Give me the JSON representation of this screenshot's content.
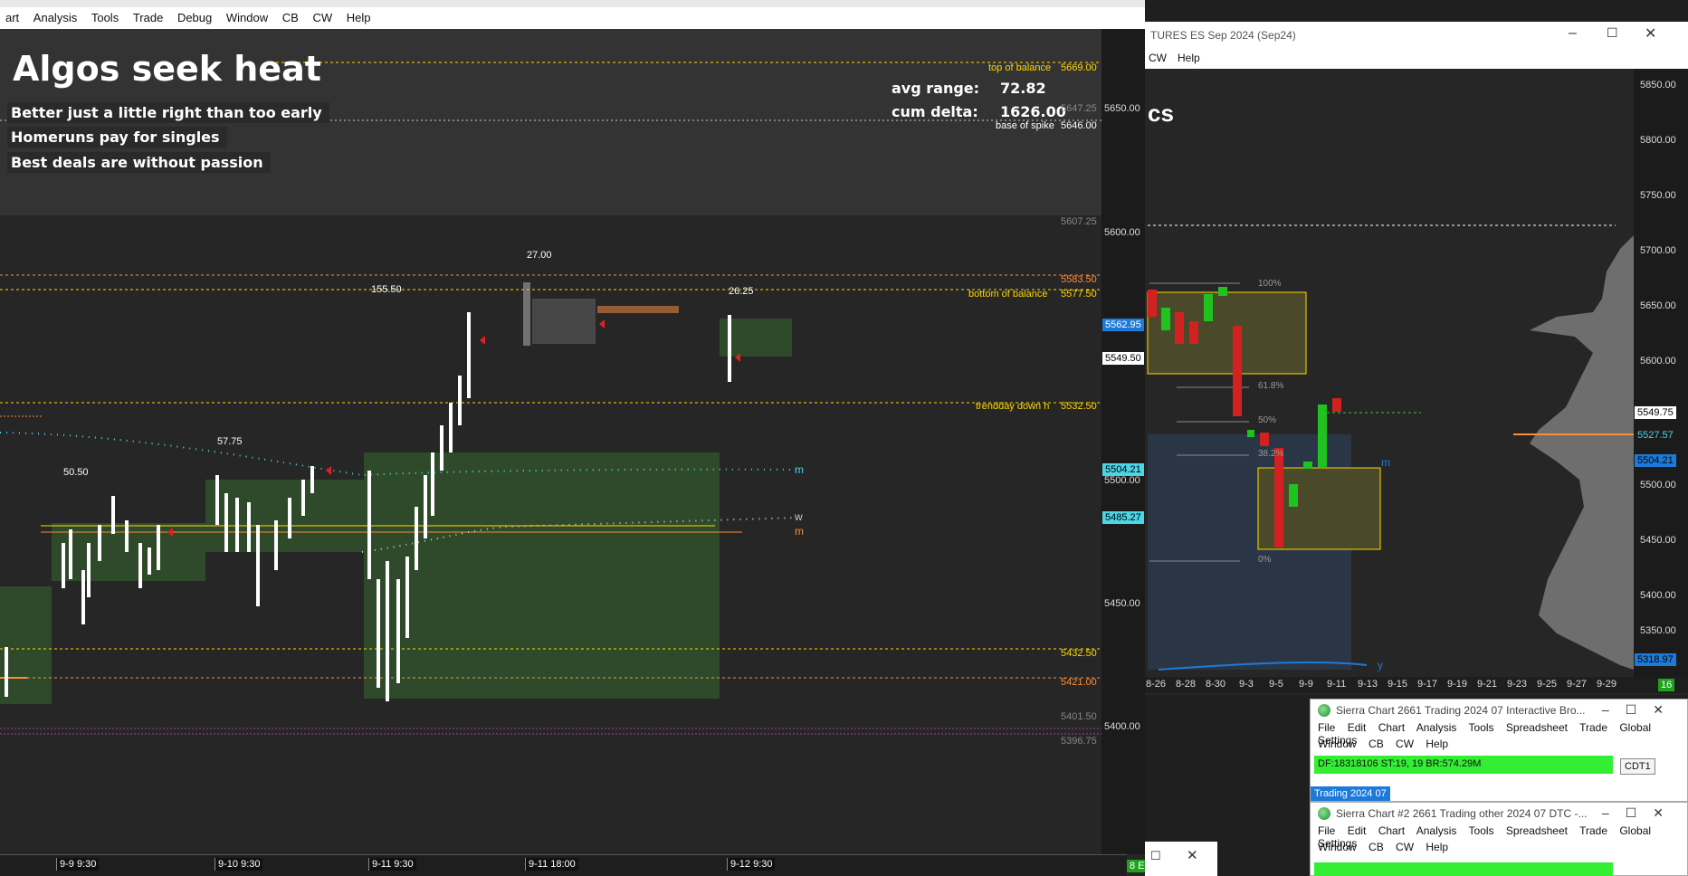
{
  "left_window": {
    "menu": [
      "art",
      "Analysis",
      "Tools",
      "Trade",
      "Debug",
      "Window",
      "CB",
      "CW",
      "Help"
    ],
    "title": "Algos seek heat",
    "mottos": [
      "Better just a little right than too early",
      "Homeruns pay for singles",
      "Best deals are without passion"
    ],
    "avg_range_label": "avg range:",
    "avg_range_value": "72.82",
    "cum_delta_label": "cum delta:",
    "cum_delta_value": "1626.00",
    "levels": {
      "top_of_balance_label": "top of balance",
      "top_of_balance_value": "5669.00",
      "base_of_spike_label": "base of spike",
      "base_of_spike_value": "5646.00",
      "bottom_of_balance_label": "bottom of balance",
      "bottom_of_balance_value": "5577.50",
      "trendday_label": "trendday down h",
      "trendday_value": "5532.50",
      "orange_top": "5583.50",
      "yellow_low": "5432.50",
      "orange_low": "5421.00",
      "gray_1": "5647.25",
      "gray_2": "5607.25",
      "gray_3": "5401.50",
      "gray_4": "5396.75"
    },
    "price_scale": [
      "5650.00",
      "5600.00",
      "5549.50",
      "5500.00",
      "5450.00",
      "5400.00"
    ],
    "price_tags": {
      "blue_1": "5562.95",
      "cyan_1": "5504.21",
      "cyan_2": "5485.27",
      "current": "5549.50"
    },
    "bar_labels": [
      "27.00",
      "155.50",
      "26.25",
      "57.75",
      "50.50"
    ],
    "line_markers": [
      "m",
      "w",
      "m"
    ],
    "time_labels": [
      "9-9 9:30",
      "9-10 9:30",
      "9-11 9:30",
      "9-11 18:00",
      "9-12 9:30"
    ],
    "corner_badge": "8 E"
  },
  "right_window": {
    "title": "TURES ES Sep 2024 (Sep24)",
    "menu": [
      "CW",
      "Help"
    ],
    "partial_title": "cs",
    "price_scale": [
      "5850.00",
      "5800.00",
      "5750.00",
      "5700.00",
      "5650.00",
      "5600.00",
      "5500.00",
      "5450.00",
      "5400.00",
      "5350.00",
      "5300.00"
    ],
    "price_tags": {
      "current": "5549.75",
      "poc": "5527.57",
      "blue": "5504.21",
      "low": "5318.97"
    },
    "fib_labels": [
      "100%",
      "61.8%",
      "50%",
      "38.2%",
      "0%"
    ],
    "markers": [
      "m",
      "y"
    ],
    "time_labels": [
      "8-26",
      "8-28",
      "8-30",
      "9-3",
      "9-5",
      "9-9",
      "9-11",
      "9-13",
      "9-15",
      "9-17",
      "9-19",
      "9-21",
      "9-23",
      "9-25",
      "9-27",
      "9-29"
    ],
    "corner_badge": "16"
  },
  "sc_window_1": {
    "title": "Sierra Chart 2661 Trading 2024 07 Interactive Bro...",
    "menu_row1": [
      "File",
      "Edit",
      "Chart",
      "Analysis",
      "Tools",
      "Spreadsheet",
      "Trade",
      "Global Settings"
    ],
    "menu_row2": [
      "Window",
      "CB",
      "CW",
      "Help"
    ],
    "status": "DF:18318106  ST:19, 19  BR:574.29M",
    "status_right": "CDT1",
    "tab": "Trading 2024 07"
  },
  "sc_window_2": {
    "title": "Sierra Chart #2 2661 Trading other 2024 07 DTC -...",
    "menu_row1": [
      "File",
      "Edit",
      "Chart",
      "Analysis",
      "Tools",
      "Spreadsheet",
      "Trade",
      "Global Settings"
    ],
    "menu_row2": [
      "Window",
      "CB",
      "CW",
      "Help"
    ]
  },
  "colors": {
    "background": "#262626",
    "yellow_level": "#ffd800",
    "orange_level": "#ff8c3a",
    "green_zone": "#2f4a2a",
    "cyan_tag": "#4ad6e6",
    "blue_tag": "#1e7ad8",
    "status_green": "#33ee33"
  }
}
